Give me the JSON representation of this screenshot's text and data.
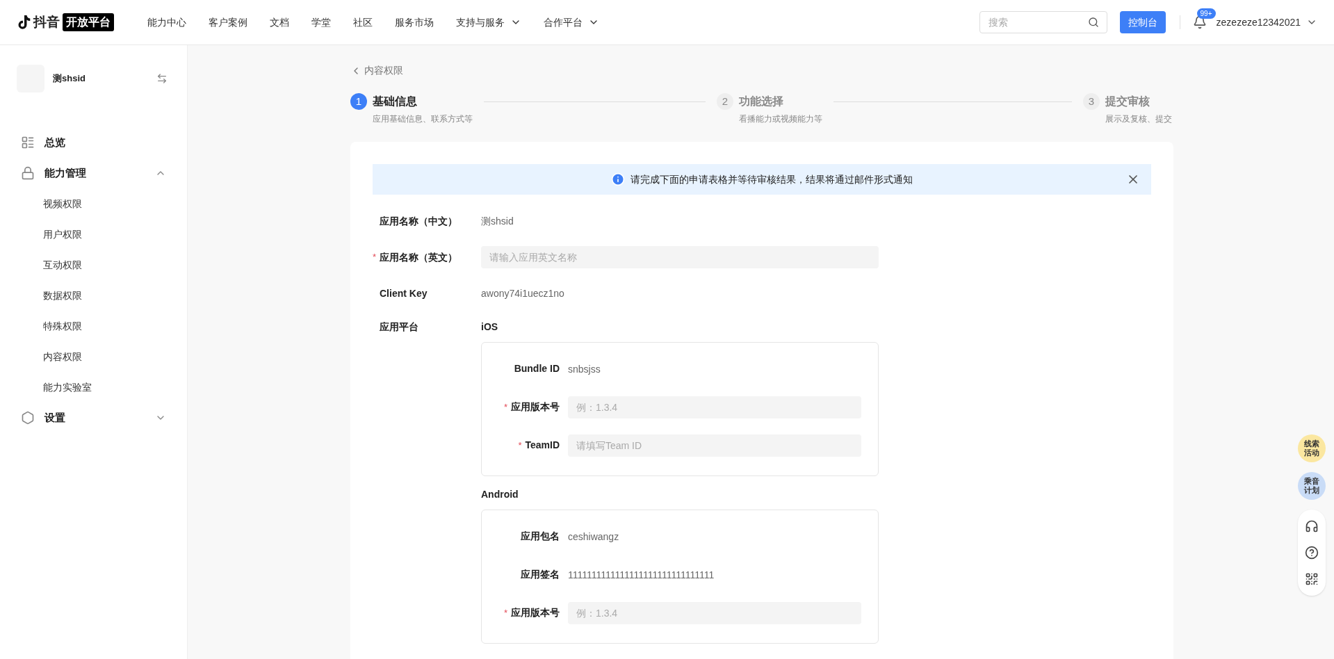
{
  "header": {
    "logo_text": "抖音",
    "logo_badge": "开放平台",
    "nav": [
      {
        "label": "能力中心",
        "kind": "link"
      },
      {
        "label": "客户案例",
        "kind": "link"
      },
      {
        "label": "文档",
        "kind": "link"
      },
      {
        "label": "学堂",
        "kind": "link"
      },
      {
        "label": "社区",
        "kind": "link"
      },
      {
        "label": "服务市场",
        "kind": "link"
      },
      {
        "label": "支持与服务",
        "kind": "dropdown"
      },
      {
        "label": "合作平台",
        "kind": "dropdown"
      }
    ],
    "search": {
      "placeholder": "搜索"
    },
    "console_button": "控制台",
    "notification_badge": "99+",
    "username": "zezezeze12342021"
  },
  "sidebar": {
    "app_name": "测shsid",
    "items": [
      {
        "label": "总览",
        "kind": "overview"
      },
      {
        "label": "能力管理",
        "kind": "lock",
        "expanded": true,
        "children": [
          {
            "label": "视频权限"
          },
          {
            "label": "用户权限"
          },
          {
            "label": "互动权限"
          },
          {
            "label": "数据权限"
          },
          {
            "label": "特殊权限"
          },
          {
            "label": "内容权限"
          },
          {
            "label": "能力实验室"
          }
        ]
      },
      {
        "label": "设置",
        "kind": "settings",
        "expanded": false
      }
    ]
  },
  "required_mark": "*",
  "breadcrumb": "内容权限",
  "steps": [
    {
      "number": "1",
      "title": "基础信息",
      "subtitle": "应用基础信息、联系方式等",
      "selected": true
    },
    {
      "number": "2",
      "title": "功能选择",
      "subtitle": "看播能力或视频能力等",
      "selected": false
    },
    {
      "number": "3",
      "title": "提交审核",
      "subtitle": "展示及复核、提交",
      "selected": false
    }
  ],
  "alert": "请完成下面的申请表格并等待审核结果，结果将通过邮件形式通知",
  "form": [
    {
      "label": "应用名称（中文）",
      "kind": "text",
      "required": false,
      "value": "测shsid"
    },
    {
      "label": "应用名称（英文）",
      "kind": "input",
      "required": true,
      "placeholder": "请输入应用英文名称"
    },
    {
      "label": "Client Key",
      "kind": "text",
      "required": false,
      "value": "awony74i1uecz1no"
    }
  ],
  "platform_label": "应用平台",
  "platforms": [
    {
      "name": "iOS",
      "fields": [
        {
          "label": "Bundle ID",
          "kind": "text",
          "required": false,
          "value": "snbsjss"
        },
        {
          "label": "应用版本号",
          "kind": "input",
          "required": true,
          "placeholder": "例：1.3.4"
        },
        {
          "label": "TeamID",
          "kind": "input",
          "required": true,
          "placeholder": "请填写Team ID"
        }
      ]
    },
    {
      "name": "Android",
      "fields": [
        {
          "label": "应用包名",
          "kind": "text",
          "required": false,
          "value": "ceshiwangz"
        },
        {
          "label": "应用签名",
          "kind": "text",
          "required": false,
          "value": "1111111111111111111111111111111"
        },
        {
          "label": "应用版本号",
          "kind": "input",
          "required": true,
          "placeholder": "例：1.3.4"
        }
      ]
    }
  ],
  "floating": [
    {
      "label": "线索活动",
      "color": "#fbe7a0"
    },
    {
      "label": "乘音计划",
      "color": "#c9dcf7"
    }
  ]
}
